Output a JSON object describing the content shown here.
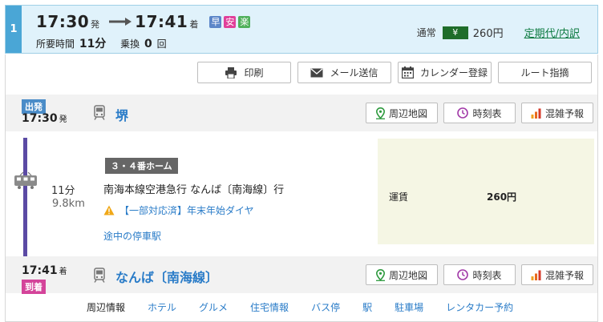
{
  "summary": {
    "route_number": "1",
    "departure_time": "17:30",
    "departure_suffix": "発",
    "arrival_time": "17:41",
    "arrival_suffix": "着",
    "badges": [
      "早",
      "安",
      "楽"
    ],
    "duration_label": "所要時間",
    "duration_value": "11分",
    "transfer_label": "乗換",
    "transfer_count": "0",
    "transfer_unit": "回",
    "fare_type": "通常",
    "yen_symbol": "¥",
    "fare": "260円",
    "commuter_link": "定期代/内訳"
  },
  "actions": {
    "print": "印刷",
    "mail": "メール送信",
    "calendar": "カレンダー登録",
    "route_request": "ルート指摘"
  },
  "departure": {
    "tag": "出発",
    "time": "17:30",
    "time_suffix": "発",
    "station": "堺",
    "buttons": [
      "周辺地図",
      "時刻表",
      "混雑予報"
    ]
  },
  "segment": {
    "platform": "３・４番ホーム",
    "duration": "11分",
    "distance": "9.8km",
    "train": "南海本線空港急行 なんば〔南海線〕行",
    "notice": "【一部対応済】年末年始ダイヤ",
    "stops_link": "途中の停車駅",
    "fare_label": "運賃",
    "fare_value": "260円"
  },
  "arrival": {
    "tag": "到着",
    "time": "17:41",
    "time_suffix": "着",
    "station": "なんば〔南海線〕",
    "buttons": [
      "周辺地図",
      "時刻表",
      "混雑予報"
    ]
  },
  "nearby": {
    "label": "周辺情報",
    "links": [
      "ホテル",
      "グルメ",
      "住宅情報",
      "バス停",
      "駅",
      "駐車場",
      "レンタカー予約"
    ]
  },
  "colors": {
    "summary_bg": "#e0f2fb",
    "route_num_bg": "#4aa6d6",
    "link_blue": "#2a7cc8",
    "commuter_green": "#0c7a3f",
    "line_color": "#5b4aa4",
    "fare_panel_bg": "#f5f6e4"
  }
}
